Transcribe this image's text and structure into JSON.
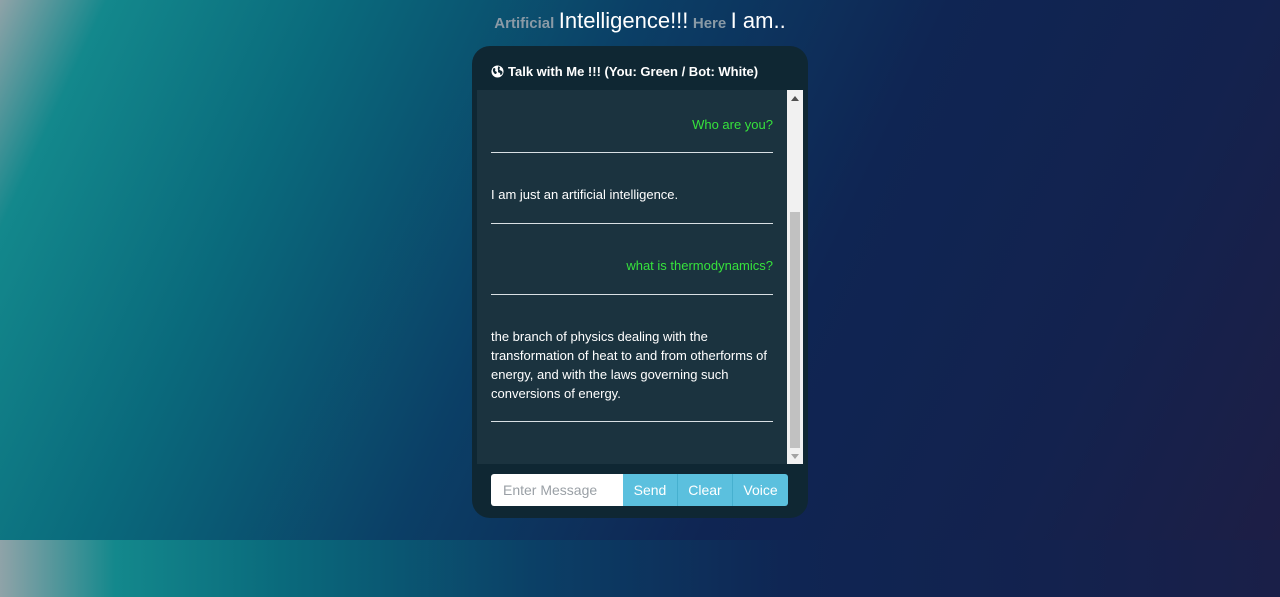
{
  "headline": {
    "part1": "Artificial",
    "part2": "Intelligence!!!",
    "part3": "Here",
    "part4": "I am.."
  },
  "chat": {
    "header_icon": "globe-icon",
    "title": "Talk with Me !!! (You: Green / Bot: White)",
    "messages": [
      {
        "sender": "user",
        "text": "Who are you?"
      },
      {
        "sender": "bot",
        "text": "I am just an artificial intelligence."
      },
      {
        "sender": "user",
        "text": "what is thermodynamics?"
      },
      {
        "sender": "bot",
        "text": "the branch of physics dealing with the transformation of heat to and from otherforms of energy, and with the laws governing such conversions of energy."
      }
    ]
  },
  "input": {
    "placeholder": "Enter Message",
    "value": ""
  },
  "buttons": {
    "send": "Send",
    "clear": "Clear",
    "voice": "Voice"
  },
  "colors": {
    "user_text": "#36e23c",
    "bot_text": "#ffffff",
    "button_accent": "#5bc0de",
    "card_background": "#0f2733",
    "chat_background": "#1b333f"
  }
}
